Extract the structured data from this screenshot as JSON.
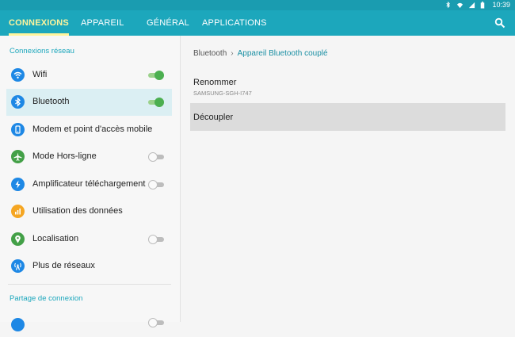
{
  "status_bar": {
    "time": "10:39"
  },
  "tabs": [
    {
      "label": "CONNEXIONS",
      "active": true
    },
    {
      "label": "APPAREIL",
      "active": false
    },
    {
      "label": "GÉNÉRAL",
      "active": false
    },
    {
      "label": "APPLICATIONS",
      "active": false
    }
  ],
  "sidebar": {
    "section1": "Connexions réseau",
    "items": [
      {
        "label": "Wifi",
        "icon": "wifi-icon",
        "color": "#1e88e5",
        "toggle": "on"
      },
      {
        "label": "Bluetooth",
        "icon": "bluetooth-icon",
        "color": "#1e88e5",
        "toggle": "on",
        "selected": true
      },
      {
        "label": "Modem et point d'accès mobile",
        "icon": "hotspot-icon",
        "color": "#1e88e5"
      },
      {
        "label": "Mode Hors-ligne",
        "icon": "airplane-icon",
        "color": "#43a047",
        "toggle": "off"
      },
      {
        "label": "Amplificateur téléchargement",
        "icon": "download-booster-icon",
        "color": "#1e88e5",
        "toggle": "off"
      },
      {
        "label": "Utilisation des données",
        "icon": "data-usage-icon",
        "color": "#f5a623"
      },
      {
        "label": "Localisation",
        "icon": "location-icon",
        "color": "#43a047",
        "toggle": "off"
      },
      {
        "label": "Plus de réseaux",
        "icon": "more-networks-icon",
        "color": "#1e88e5"
      }
    ],
    "section2": "Partage de connexion"
  },
  "detail": {
    "breadcrumb_root": "Bluetooth",
    "breadcrumb_current": "Appareil Bluetooth couplé",
    "rename_label": "Renommer",
    "device_name": "SAMSUNG-SGH-I747",
    "unpair_label": "Découpler"
  },
  "colors": {
    "accent": "#1ca7bc",
    "active_tab": "#fff59d",
    "toggle_on": "#4caf50"
  }
}
